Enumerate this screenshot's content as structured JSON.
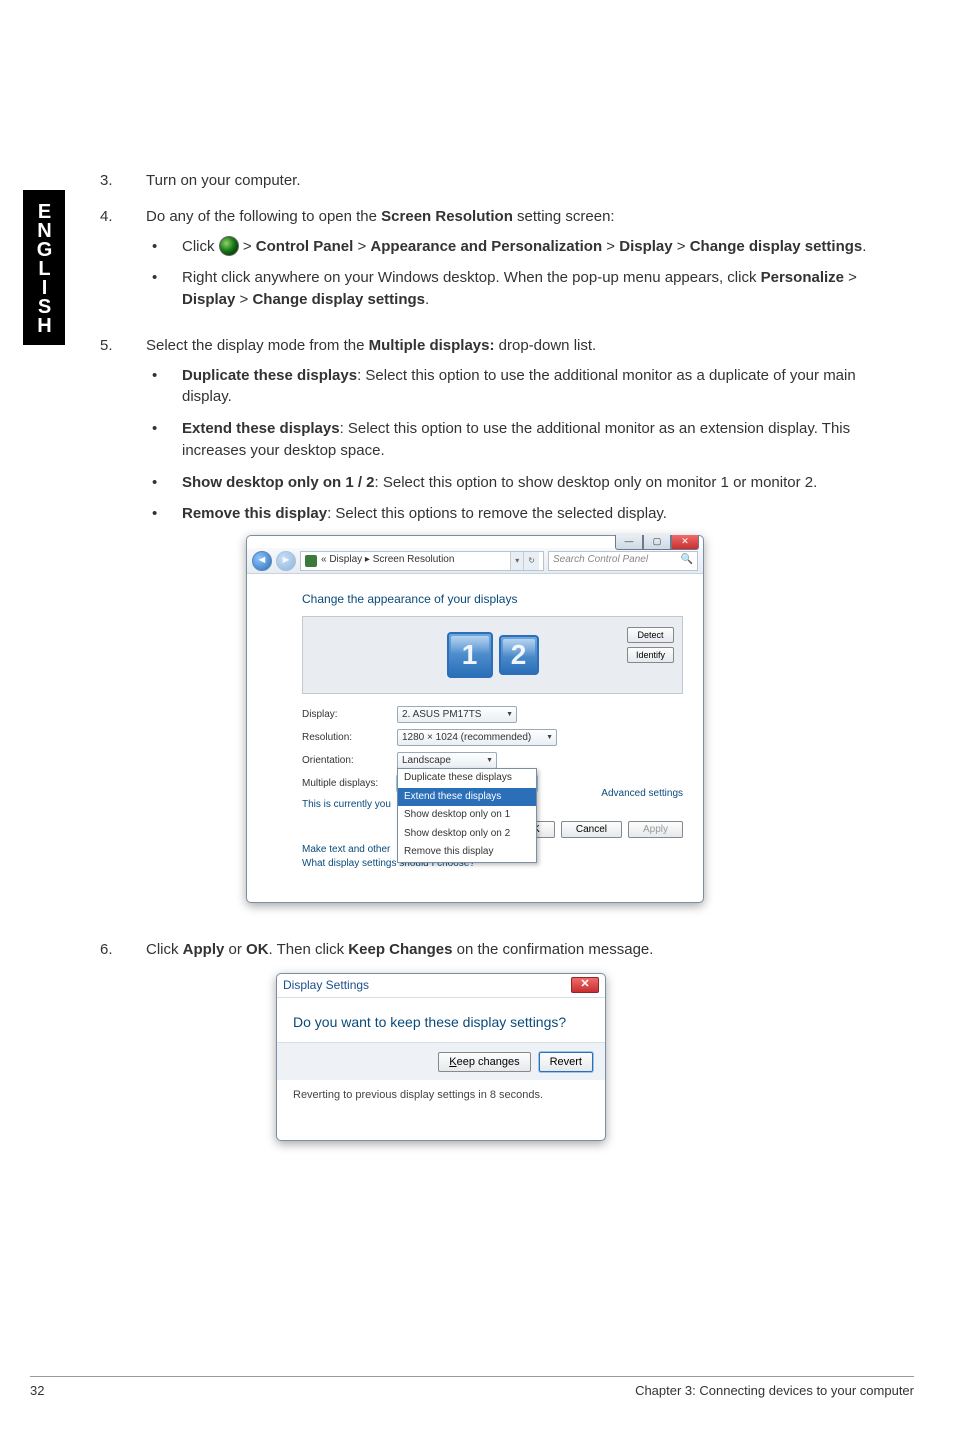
{
  "side_tab": "ENGLISH",
  "steps": {
    "s3": {
      "num": "3.",
      "text": "Turn on your computer."
    },
    "s4": {
      "num": "4.",
      "intro_a": "Do any of the following to open the ",
      "intro_b_bold": "Screen Resolution",
      "intro_c": " setting screen:",
      "bullets": [
        {
          "pre": "Click ",
          "gt1": " > ",
          "b1": "Control Panel",
          "gt2": " > ",
          "b2": "Appearance and Personalization",
          "gt3": " > ",
          "b3": "Display",
          "gt4": " > ",
          "b4": "Change display settings",
          "post": "."
        },
        {
          "line1": "Right click anywhere on your Windows desktop. When the pop-up menu appears, click ",
          "b1": "Personalize",
          "gt1": " > ",
          "b2": "Display",
          "gt2": " > ",
          "b3": "Change display settings",
          "post": "."
        }
      ]
    },
    "s5": {
      "num": "5.",
      "intro_a": "Select the display mode from the ",
      "intro_b_bold": "Multiple displays:",
      "intro_c": " drop-down list.",
      "bullets": [
        {
          "b": "Duplicate these displays",
          "t": ": Select this option to use the additional monitor as a duplicate of your main display."
        },
        {
          "b": "Extend these displays",
          "t": ": Select this option to use the additional monitor as an extension display. This increases your desktop space."
        },
        {
          "b": "Show desktop only on 1 / 2",
          "t": ": Select this option to show desktop only on monitor 1 or monitor 2."
        },
        {
          "b": "Remove this display",
          "t": ": Select this options to remove the selected display."
        }
      ]
    },
    "s6": {
      "num": "6.",
      "a": "Click ",
      "b1": "Apply",
      "mid": " or ",
      "b2": "OK",
      "c": ". Then click ",
      "b3": "Keep Changes",
      "d": " on the confirmation message."
    }
  },
  "shot1": {
    "breadcrumb": "«  Display  ▸  Screen Resolution",
    "search_placeholder": "Search Control Panel",
    "heading": "Change the appearance of your displays",
    "detect": "Detect",
    "identify": "Identify",
    "mon1": "1",
    "mon2": "2",
    "labels": {
      "display": "Display:",
      "resolution": "Resolution:",
      "orientation": "Orientation:",
      "multiple": "Multiple displays:"
    },
    "values": {
      "display": "2. ASUS PM17TS",
      "resolution": "1280 × 1024 (recommended)",
      "orientation": "Landscape",
      "multiple": "Duplicate these displays"
    },
    "dropdown": {
      "opt1": "Duplicate these displays",
      "opt2": "Extend these displays",
      "opt3": "Show desktop only on 1",
      "opt4": "Show desktop only on 2",
      "opt5": "Remove this display"
    },
    "main_text_pre": "This is currently you",
    "make_text": "Make text and other",
    "what_link": "What display settings should I choose?",
    "adv": "Advanced settings",
    "ok": "OK",
    "cancel": "Cancel",
    "apply": "Apply"
  },
  "shot2": {
    "title": "Display Settings",
    "question": "Do you want to keep these display settings?",
    "keep": "Keep changes",
    "revert": "Revert",
    "countdown": "Reverting to previous display settings in 8 seconds."
  },
  "footer": {
    "page": "32",
    "chapter": "Chapter 3: Connecting devices to your computer"
  }
}
